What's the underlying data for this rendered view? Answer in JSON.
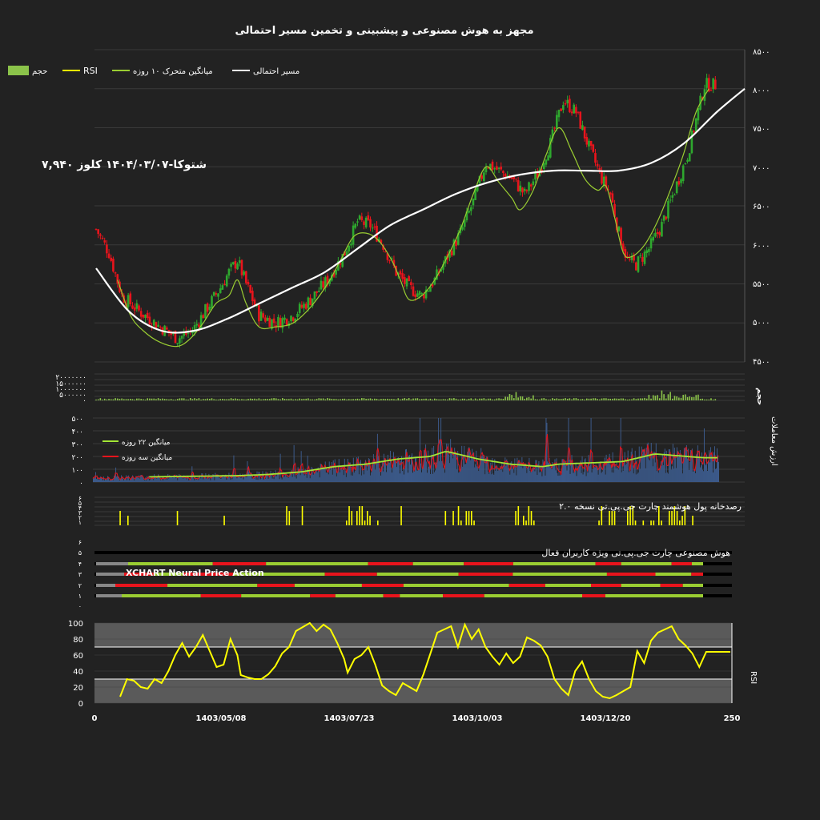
{
  "title": "مجهز به هوش مصنوعی و پیشبینی و تخمین مسیر احتمالی",
  "colors": {
    "background": "#222222",
    "up": "#2ea82e",
    "down": "#e8141c",
    "ma10": "#9acd32",
    "path": "#ffffff",
    "rsi": "#ffff00",
    "volume": "#8bc34a",
    "ma22": "#a3e635",
    "ma3": "#e8141c",
    "grid": "#3a3a3a"
  },
  "legend": [
    {
      "label": "مسیر احتمالی",
      "color": "#ffffff",
      "kind": "line"
    },
    {
      "label": "میانگین متحرک ۱۰ روزه",
      "color": "#9acd32",
      "kind": "line"
    },
    {
      "label": "RSI",
      "color": "#ffff00",
      "kind": "line"
    },
    {
      "label": "حجم",
      "color": "#8bc34a",
      "kind": "box"
    }
  ],
  "info_label": "شتوکا-۱۴۰۴/۰۳/۰۷ کلوز ۷,۹۴۰",
  "price_axis": {
    "ticks": [
      "۸۵۰۰",
      "۸۰۰۰",
      "۷۵۰۰",
      "۷۰۰۰",
      "۶۵۰۰",
      "۶۰۰۰",
      "۵۵۰۰",
      "۵۰۰۰",
      "۴۵۰۰"
    ]
  },
  "volume_axis": {
    "ticks": [
      "۲۰۰۰۰۰۰۰",
      "۱۵۰۰۰۰۰۰",
      "۱۰۰۰۰۰۰۰",
      "۵۰۰۰۰۰۰",
      "۰"
    ],
    "label": "حجم"
  },
  "value_axis": {
    "ticks": [
      "۵۰۰",
      "۴۰۰",
      "۳۰۰",
      "۲۰۰",
      "۱۰۰",
      "۰"
    ],
    "label": "ارزش معاملات"
  },
  "value_legend": [
    {
      "label": "میانگین ۲۲ روزه",
      "color": "#a3e635"
    },
    {
      "label": "میانگین سه روزه",
      "color": "#e8141c"
    }
  ],
  "pattern_panel": {
    "label": "رصدخانه پول هوشمند چارت جی.پی.تی نسخه ۲.۰",
    "ticks": [
      "۶",
      "۵",
      "۴",
      "۳",
      "۲",
      "۱"
    ]
  },
  "ai_panel": {
    "label": "هوش مصنوعی چارت جی.پی.تی ویژه کاربران فعال",
    "sublabel": "XCHART Neural Price Action",
    "ticks": [
      "۶",
      "۵",
      "۴",
      "۳",
      "۲",
      "۱",
      "۰"
    ]
  },
  "rsi_panel": {
    "label": "RSI",
    "ticks": [
      "100",
      "80",
      "60",
      "40",
      "20",
      "0"
    ],
    "upper": 70,
    "lower": 30
  },
  "x_axis": {
    "ticks": [
      "0",
      "1403/05/08",
      "1403/07/23",
      "1403/10/03",
      "1403/12/20",
      "250"
    ]
  },
  "chart_data": {
    "type": "line",
    "title": "مجهز به هوش مصنوعی و پیشبینی و تخمین مسیر احتمالی",
    "xlim": [
      0,
      250
    ],
    "price_ylim": [
      4500,
      8500
    ],
    "close_anchors": [
      [
        0,
        6200
      ],
      [
        6,
        5900
      ],
      [
        12,
        5350
      ],
      [
        20,
        5150
      ],
      [
        30,
        4950
      ],
      [
        38,
        4800
      ],
      [
        45,
        4900
      ],
      [
        52,
        5200
      ],
      [
        58,
        5450
      ],
      [
        62,
        5650
      ],
      [
        66,
        5800
      ],
      [
        70,
        5500
      ],
      [
        76,
        5100
      ],
      [
        84,
        5000
      ],
      [
        92,
        5100
      ],
      [
        100,
        5300
      ],
      [
        108,
        5550
      ],
      [
        116,
        5900
      ],
      [
        122,
        6300
      ],
      [
        128,
        6250
      ],
      [
        134,
        6000
      ],
      [
        140,
        5650
      ],
      [
        146,
        5450
      ],
      [
        152,
        5350
      ],
      [
        158,
        5550
      ],
      [
        164,
        5850
      ],
      [
        170,
        6150
      ],
      [
        176,
        6550
      ],
      [
        182,
        7050
      ],
      [
        188,
        6950
      ],
      [
        194,
        6850
      ],
      [
        200,
        6650
      ],
      [
        206,
        6900
      ],
      [
        212,
        7300
      ],
      [
        218,
        7850
      ],
      [
        224,
        7700
      ],
      [
        230,
        7250
      ],
      [
        236,
        6850
      ],
      [
        240,
        6650
      ],
      [
        244,
        6150
      ],
      [
        248,
        5800
      ],
      [
        252,
        5750
      ],
      [
        258,
        5950
      ],
      [
        264,
        6250
      ],
      [
        270,
        6700
      ],
      [
        276,
        7150
      ],
      [
        280,
        7600
      ],
      [
        284,
        8050
      ],
      [
        288,
        8050
      ]
    ],
    "ma10_anchors": [
      [
        10,
        5550
      ],
      [
        16,
        5100
      ],
      [
        22,
        4900
      ],
      [
        30,
        4750
      ],
      [
        38,
        4700
      ],
      [
        44,
        4800
      ],
      [
        50,
        5000
      ],
      [
        56,
        5250
      ],
      [
        62,
        5350
      ],
      [
        66,
        5550
      ],
      [
        70,
        5250
      ],
      [
        76,
        4950
      ],
      [
        84,
        4950
      ],
      [
        92,
        5000
      ],
      [
        100,
        5200
      ],
      [
        108,
        5500
      ],
      [
        114,
        5800
      ],
      [
        120,
        6100
      ],
      [
        126,
        6150
      ],
      [
        132,
        6050
      ],
      [
        138,
        5800
      ],
      [
        142,
        5550
      ],
      [
        146,
        5300
      ],
      [
        152,
        5350
      ],
      [
        158,
        5550
      ],
      [
        164,
        5850
      ],
      [
        170,
        6200
      ],
      [
        176,
        6650
      ],
      [
        182,
        7000
      ],
      [
        188,
        6800
      ],
      [
        194,
        6600
      ],
      [
        198,
        6450
      ],
      [
        204,
        6700
      ],
      [
        210,
        7150
      ],
      [
        216,
        7500
      ],
      [
        222,
        7200
      ],
      [
        228,
        6850
      ],
      [
        234,
        6700
      ],
      [
        238,
        6750
      ],
      [
        242,
        6350
      ],
      [
        246,
        5900
      ],
      [
        250,
        5850
      ],
      [
        256,
        6000
      ],
      [
        262,
        6300
      ],
      [
        268,
        6700
      ],
      [
        274,
        7150
      ],
      [
        280,
        7700
      ],
      [
        286,
        8000
      ]
    ],
    "path_anchors": [
      [
        0,
        5700
      ],
      [
        14,
        5150
      ],
      [
        28,
        4900
      ],
      [
        42,
        4900
      ],
      [
        56,
        5050
      ],
      [
        70,
        5250
      ],
      [
        84,
        5450
      ],
      [
        98,
        5650
      ],
      [
        112,
        5950
      ],
      [
        126,
        6250
      ],
      [
        140,
        6450
      ],
      [
        154,
        6650
      ],
      [
        168,
        6800
      ],
      [
        182,
        6900
      ],
      [
        196,
        6950
      ],
      [
        210,
        6950
      ],
      [
        224,
        6950
      ],
      [
        238,
        7050
      ],
      [
        252,
        7300
      ],
      [
        266,
        7700
      ],
      [
        278,
        8000
      ]
    ],
    "rsi_anchors": [
      [
        10,
        8
      ],
      [
        14,
        30
      ],
      [
        18,
        28
      ],
      [
        22,
        20
      ],
      [
        26,
        18
      ],
      [
        30,
        30
      ],
      [
        34,
        25
      ],
      [
        38,
        40
      ],
      [
        42,
        60
      ],
      [
        46,
        75
      ],
      [
        50,
        58
      ],
      [
        54,
        70
      ],
      [
        58,
        85
      ],
      [
        62,
        65
      ],
      [
        66,
        45
      ],
      [
        70,
        48
      ],
      [
        74,
        80
      ],
      [
        78,
        60
      ],
      [
        80,
        35
      ],
      [
        84,
        32
      ],
      [
        88,
        30
      ],
      [
        92,
        30
      ],
      [
        96,
        36
      ],
      [
        100,
        46
      ],
      [
        104,
        62
      ],
      [
        108,
        70
      ],
      [
        112,
        90
      ],
      [
        116,
        95
      ],
      [
        120,
        100
      ],
      [
        124,
        90
      ],
      [
        128,
        98
      ],
      [
        132,
        92
      ],
      [
        136,
        75
      ],
      [
        140,
        55
      ],
      [
        142,
        38
      ],
      [
        146,
        55
      ],
      [
        150,
        60
      ],
      [
        154,
        70
      ],
      [
        158,
        48
      ],
      [
        162,
        22
      ],
      [
        166,
        15
      ],
      [
        170,
        10
      ],
      [
        174,
        25
      ],
      [
        178,
        20
      ],
      [
        182,
        15
      ],
      [
        186,
        36
      ],
      [
        190,
        62
      ],
      [
        194,
        88
      ],
      [
        198,
        92
      ],
      [
        202,
        96
      ],
      [
        206,
        70
      ],
      [
        210,
        98
      ],
      [
        214,
        80
      ],
      [
        218,
        92
      ],
      [
        222,
        70
      ],
      [
        226,
        58
      ],
      [
        230,
        48
      ],
      [
        234,
        62
      ],
      [
        238,
        50
      ],
      [
        242,
        58
      ],
      [
        246,
        82
      ],
      [
        250,
        78
      ],
      [
        254,
        72
      ],
      [
        258,
        58
      ],
      [
        262,
        30
      ],
      [
        266,
        18
      ],
      [
        270,
        10
      ],
      [
        274,
        40
      ],
      [
        278,
        52
      ],
      [
        282,
        30
      ],
      [
        286,
        15
      ],
      [
        290,
        8
      ],
      [
        294,
        6
      ],
      [
        298,
        10
      ],
      [
        302,
        15
      ],
      [
        306,
        20
      ],
      [
        310,
        65
      ],
      [
        314,
        50
      ],
      [
        318,
        78
      ],
      [
        322,
        88
      ],
      [
        326,
        92
      ],
      [
        330,
        96
      ],
      [
        334,
        80
      ],
      [
        338,
        72
      ],
      [
        342,
        62
      ],
      [
        346,
        45
      ],
      [
        350,
        64
      ],
      [
        358,
        64
      ],
      [
        364,
        64
      ]
    ],
    "value_ma22_anchors": [
      [
        0,
        30
      ],
      [
        60,
        40
      ],
      [
        120,
        45
      ],
      [
        180,
        50
      ],
      [
        220,
        60
      ],
      [
        260,
        80
      ],
      [
        300,
        120
      ],
      [
        340,
        140
      ],
      [
        380,
        180
      ],
      [
        420,
        200
      ],
      [
        440,
        240
      ],
      [
        480,
        180
      ],
      [
        520,
        140
      ],
      [
        560,
        120
      ],
      [
        580,
        140
      ],
      [
        620,
        150
      ],
      [
        660,
        160
      ],
      [
        700,
        220
      ],
      [
        760,
        190
      ]
    ],
    "volume_level": "low",
    "pattern_counts": "sparse"
  }
}
